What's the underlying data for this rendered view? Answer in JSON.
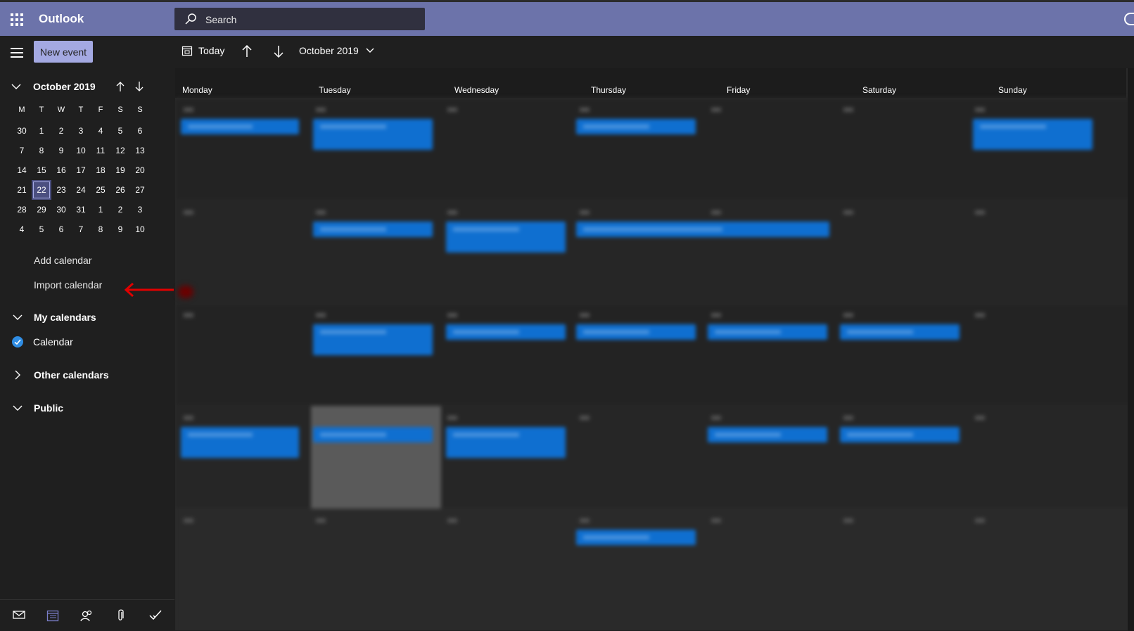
{
  "app": {
    "name": "Outlook"
  },
  "search": {
    "placeholder": "Search"
  },
  "toolbar": {
    "new_event_label": "New event",
    "today_label": "Today",
    "month_label": "October 2019"
  },
  "mini_calendar": {
    "title": "October 2019",
    "dow": [
      "M",
      "T",
      "W",
      "T",
      "F",
      "S",
      "S"
    ],
    "weeks": [
      [
        "30",
        "1",
        "2",
        "3",
        "4",
        "5",
        "6"
      ],
      [
        "7",
        "8",
        "9",
        "10",
        "11",
        "12",
        "13"
      ],
      [
        "14",
        "15",
        "16",
        "17",
        "18",
        "19",
        "20"
      ],
      [
        "21",
        "22",
        "23",
        "24",
        "25",
        "26",
        "27"
      ],
      [
        "28",
        "29",
        "30",
        "31",
        "1",
        "2",
        "3"
      ],
      [
        "4",
        "5",
        "6",
        "7",
        "8",
        "9",
        "10"
      ]
    ],
    "selected": "22"
  },
  "links": {
    "add_calendar": "Add calendar",
    "import_calendar": "Import calendar"
  },
  "groups": {
    "my_calendars": "My calendars",
    "calendar_item": "Calendar",
    "other_calendars": "Other calendars",
    "public": "Public"
  },
  "grid": {
    "days": [
      "Monday",
      "Tuesday",
      "Wednesday",
      "Thursday",
      "Friday",
      "Saturday",
      "Sunday"
    ]
  },
  "colors": {
    "header": "#6c73aa",
    "accent_button": "#a4a9e2",
    "event": "#0f6fd0",
    "checkmark": "#2f8de4",
    "annotation_arrow": "#e00000"
  },
  "icons": {
    "app_launcher": "waffle-icon",
    "search": "search-icon",
    "menu": "hamburger-icon",
    "today": "calendar-today-icon",
    "up": "arrow-up-icon",
    "down": "arrow-down-icon",
    "chevron": "chevron-down-icon",
    "mail": "mail-icon",
    "calendar": "calendar-icon",
    "people": "people-icon",
    "attach": "paperclip-icon",
    "todo": "todo-check-icon"
  }
}
